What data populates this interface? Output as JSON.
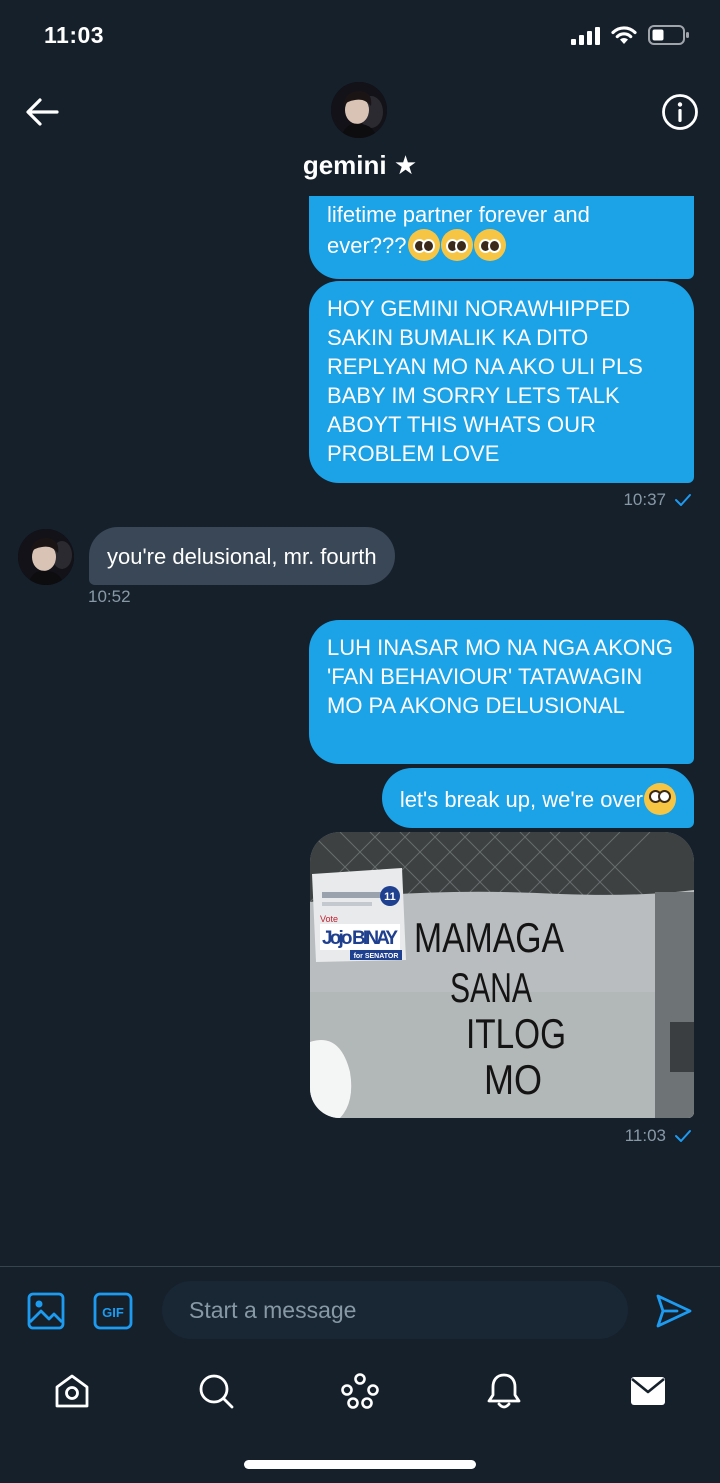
{
  "status_bar": {
    "time": "11:03"
  },
  "header": {
    "contact_name": "gemini ★"
  },
  "messages": {
    "m1": {
      "line_partial": "lifetime partner forever and",
      "line_end": "ever???"
    },
    "m2": {
      "text": "HOY GEMINI NORAWHIPPED SAKIN BUMALIK KA DITO REPLYAN MO NA AKO ULI PLS BABY IM SORRY LETS TALK ABOYT THIS WHATS OUR PROBLEM LOVE"
    },
    "m2_time": "10:37",
    "m3": {
      "text": "you're delusional, mr. fourth"
    },
    "m3_time": "10:52",
    "m4": {
      "text": "LUH INASAR MO NA NGA AKONG 'FAN BEHAVIOUR' TATAWAGIN MO PA AKONG DELUSIONAL"
    },
    "m5": {
      "text": "let's break up, we're over"
    },
    "photo": {
      "poster_vote": "Vote",
      "poster_name": "Jojo BINAY",
      "poster_role": "for SENATOR",
      "poster_number": "11",
      "wall_text": [
        "MAMAGA",
        "SANA",
        "ITLOG",
        "MO"
      ]
    },
    "last_time": "11:03"
  },
  "composer": {
    "placeholder": "Start a message",
    "gif_label": "GIF"
  },
  "icons": {
    "back": "arrow-left-icon",
    "info": "info-icon",
    "image": "image-icon",
    "gif": "gif-icon",
    "send": "send-icon",
    "home": "home-icon",
    "search": "search-icon",
    "spaces": "communities-icon",
    "notifications": "bell-icon",
    "messages": "mail-icon"
  },
  "colors": {
    "background": "#15202b",
    "sent_bubble": "#1ca2e6",
    "received_bubble": "#3a4756",
    "accent": "#1d9bf0",
    "muted_text": "#8899a6"
  }
}
